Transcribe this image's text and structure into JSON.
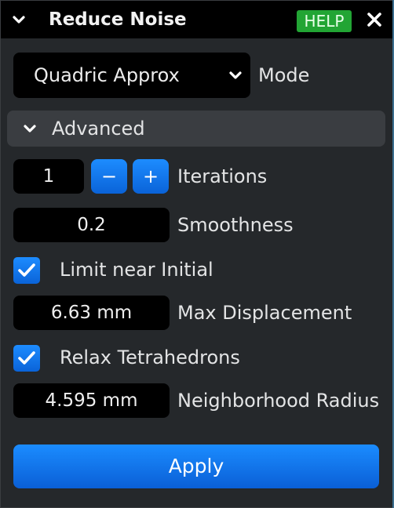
{
  "title_bar": {
    "title": "Reduce Noise",
    "help_label": "HELP",
    "collapse_icon": "chevron-down-icon",
    "close_icon": "close-icon"
  },
  "mode": {
    "selected": "Quadric Approx",
    "label": "Mode"
  },
  "advanced": {
    "title": "Advanced",
    "expanded": true
  },
  "iterations": {
    "value": "1",
    "minus_label": "−",
    "plus_label": "+",
    "label": "Iterations"
  },
  "smoothness": {
    "value": "0.2",
    "label": "Smoothness"
  },
  "limit_near_initial": {
    "checked": true,
    "label": "Limit near Initial"
  },
  "max_displacement": {
    "value": "6.63 mm",
    "label": "Max Displacement"
  },
  "relax_tetrahedrons": {
    "checked": true,
    "label": "Relax Tetrahedrons"
  },
  "neighborhood_radius": {
    "value": "4.595 mm",
    "label": "Neighborhood Radius"
  },
  "apply": {
    "label": "Apply"
  },
  "colors": {
    "accent_blue": "#0a74f0",
    "help_green": "#22a534",
    "panel_bg": "#25282b",
    "field_bg": "#000000"
  }
}
